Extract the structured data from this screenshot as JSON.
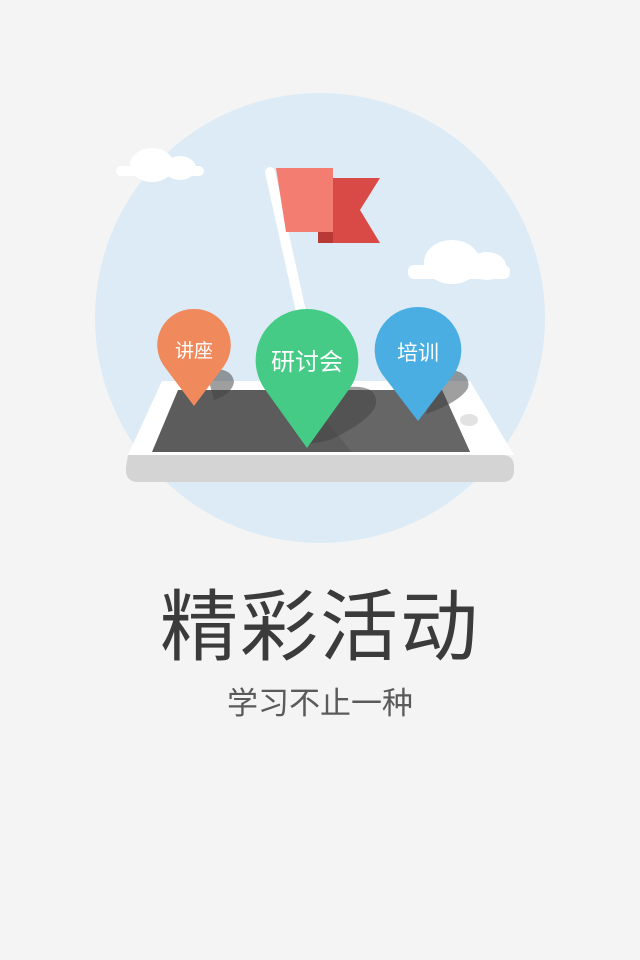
{
  "onboarding": {
    "title": "精彩活动",
    "subtitle": "学习不止一种",
    "pins": [
      {
        "label": "讲座",
        "color": "#f08a5d"
      },
      {
        "label": "研讨会",
        "color": "#45cb85"
      },
      {
        "label": "培训",
        "color": "#4aaee3"
      }
    ]
  },
  "colors": {
    "background": "#f4f4f4",
    "circle": "#dcebf5",
    "flag_light": "#f47d72",
    "flag_dark": "#d94a46",
    "tablet_frame": "#ffffff",
    "tablet_screen": "#5c5c5c"
  }
}
